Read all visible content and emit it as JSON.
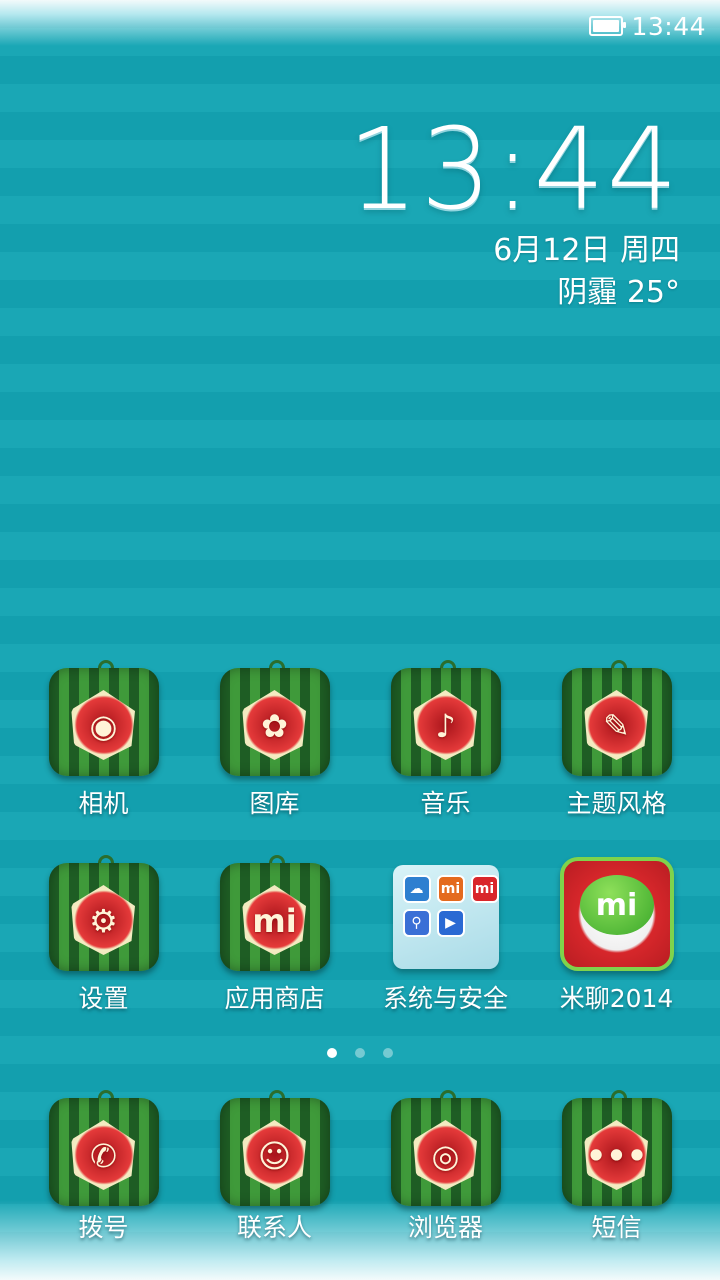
{
  "status_bar": {
    "time": "13:44",
    "battery_icon": "battery-full-icon"
  },
  "clock_widget": {
    "time": "13:44",
    "date": "6月12日 周四",
    "weather": "阴霾  25°"
  },
  "home_rows": [
    [
      {
        "label": "相机",
        "icon": "camera-icon",
        "glyph": "◉"
      },
      {
        "label": "图库",
        "icon": "gallery-icon",
        "glyph": "✿"
      },
      {
        "label": "音乐",
        "icon": "music-icon",
        "glyph": "♪"
      },
      {
        "label": "主题风格",
        "icon": "theme-icon",
        "glyph": "✎"
      }
    ],
    [
      {
        "label": "设置",
        "icon": "settings-icon",
        "glyph": "⚙"
      },
      {
        "label": "应用商店",
        "icon": "app-store-icon",
        "glyph": "mi"
      },
      {
        "label": "系统与安全",
        "icon": "folder-icon",
        "glyph": ""
      },
      {
        "label": "米聊2014",
        "icon": "miliao-icon",
        "glyph": "mi"
      }
    ]
  ],
  "dock": [
    {
      "label": "拨号",
      "icon": "phone-icon",
      "glyph": "✆"
    },
    {
      "label": "联系人",
      "icon": "contacts-icon",
      "glyph": "☺"
    },
    {
      "label": "浏览器",
      "icon": "browser-icon",
      "glyph": "◎"
    },
    {
      "label": "短信",
      "icon": "messages-icon",
      "glyph": "•••"
    }
  ],
  "folder_minis": [
    {
      "icon": "cloud-icon",
      "color": "#2e7fd0",
      "glyph": "☁"
    },
    {
      "icon": "mi-icon",
      "color": "#e46a1e",
      "glyph": "mi"
    },
    {
      "icon": "mi-red-icon",
      "color": "#d9262b",
      "glyph": "mi"
    },
    {
      "icon": "search-icon",
      "color": "#3a6fd6",
      "glyph": "⚲"
    },
    {
      "icon": "play-icon",
      "color": "#2a69d3",
      "glyph": "▶"
    }
  ],
  "page_indicator": {
    "pages": 3,
    "active": 0
  },
  "colors": {
    "background": "#139fae",
    "watermelon_dark": "#1e5d24",
    "watermelon_light": "#3f9a3a",
    "flesh": "#e53a3a"
  }
}
